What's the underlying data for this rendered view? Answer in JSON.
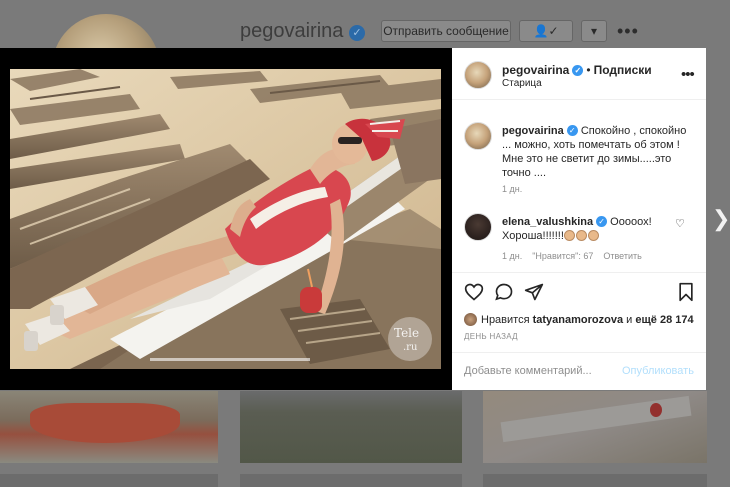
{
  "background": {
    "username": "pegovairina",
    "message_button": "Отправить сообщение",
    "follow_button": "👤✓",
    "caret_button": "▾",
    "more": "•••"
  },
  "post": {
    "author": "pegovairina",
    "dot": "•",
    "follow_state": "Подписки",
    "location": "Старица",
    "more": "•••"
  },
  "caption": {
    "user": "pegovairina",
    "text": "Спокойно , спокойно ... можно, хоть помечтать об этом ! Мне это не светит до зимы.....это точно ....",
    "time": "1 дн."
  },
  "comment": {
    "user": "elena_valushkina",
    "text": "Ооооох! Хороша!!!!!!!",
    "time": "1 дн.",
    "likes": "\"Нравится\": 67",
    "reply": "Ответить"
  },
  "likes": {
    "prefix": "Нравится",
    "user": "tatyanamorozova",
    "middle": "и",
    "others": "ещё 28 174"
  },
  "time_ago": "ДЕНЬ НАЗАД",
  "comment_box": {
    "placeholder": "Добавьте комментарий...",
    "publish": "Опубликовать"
  },
  "watermark": "Tele.ru",
  "icons": {
    "verified": "verified-icon",
    "heart": "heart-icon",
    "comment": "comment-icon",
    "share": "share-icon",
    "save": "bookmark-icon",
    "next": "chevron-right-icon"
  },
  "colors": {
    "link_blue": "#3897f0",
    "publish_disabled": "#b2dffc",
    "swimsuit": "#d8474f"
  }
}
